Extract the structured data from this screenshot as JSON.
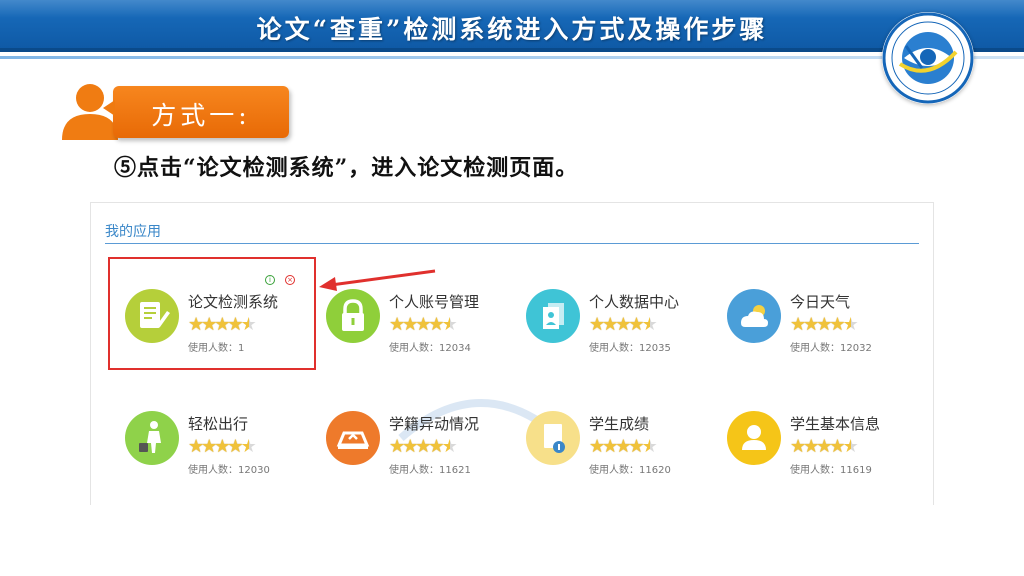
{
  "header": {
    "title": "论文“查重”检测系统进入方式及操作步骤",
    "accent_color": "#1566b8"
  },
  "method": {
    "badge_label": "方式一:",
    "badge_color": "#f07c12"
  },
  "instruction": "⑤点击“论文检测系统”，进入论文检测页面。",
  "panel": {
    "section_title": "我的应用",
    "apps": [
      {
        "name": "论文检测系统",
        "users": "使用人数：1",
        "icon": "document-edit-icon",
        "color": "#b5cf3a"
      },
      {
        "name": "个人账号管理",
        "users": "使用人数：12034",
        "icon": "lock-icon",
        "color": "#8fcf3a"
      },
      {
        "name": "个人数据中心",
        "users": "使用人数：12035",
        "icon": "data-files-icon",
        "color": "#3fc4d6"
      },
      {
        "name": "今日天气",
        "users": "使用人数：12032",
        "icon": "weather-cloud-icon",
        "color": "#4a9fd9"
      },
      {
        "name": "轻松出行",
        "users": "使用人数：12030",
        "icon": "traveler-icon",
        "color": "#8fd24a"
      },
      {
        "name": "学籍异动情况",
        "users": "使用人数：11621",
        "icon": "student-status-icon",
        "color": "#ee7a2b"
      },
      {
        "name": "学生成绩",
        "users": "使用人数：11620",
        "icon": "grade-report-icon",
        "color": "#f7e08a"
      },
      {
        "name": "学生基本信息",
        "users": "使用人数：11619",
        "icon": "user-profile-icon",
        "color": "#f5c518"
      }
    ],
    "rating_stars": 4.5,
    "highlight_color": "#e0302d"
  }
}
